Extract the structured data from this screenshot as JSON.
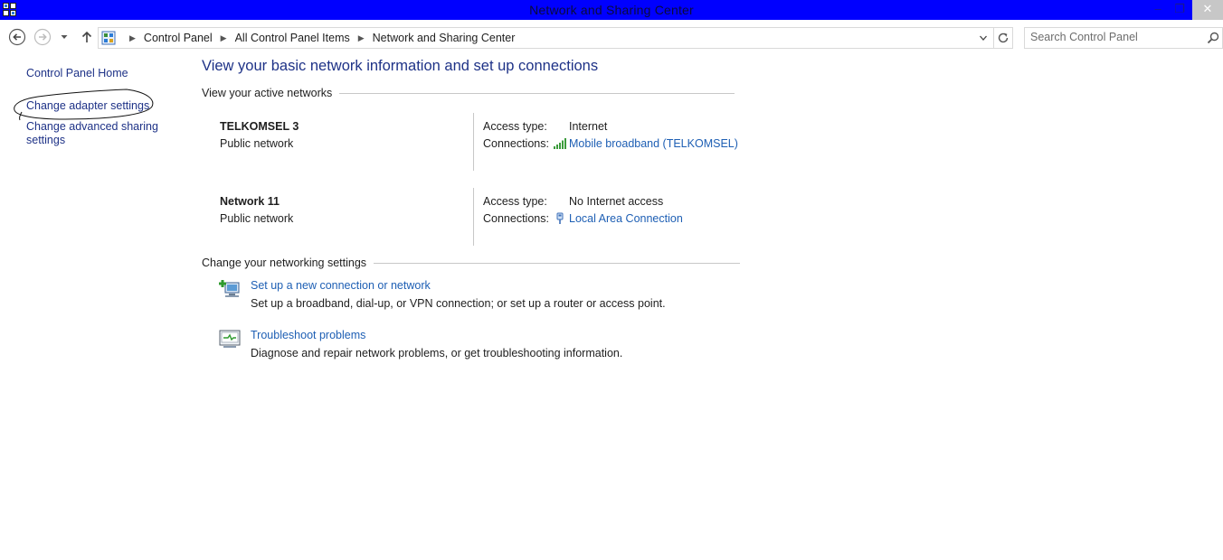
{
  "window": {
    "title": "Network and Sharing Center",
    "minimize_glyph": "–",
    "maximize_glyph": "❐",
    "close_glyph": "✕",
    "title_bar_color": "#0000ff"
  },
  "nav": {
    "back_icon": "back-arrow-icon",
    "forward_icon": "forward-arrow-icon",
    "up_icon": "up-arrow-icon",
    "breadcrumbs": [
      "Control Panel",
      "All Control Panel Items",
      "Network and Sharing Center"
    ],
    "search_placeholder": "Search Control Panel"
  },
  "sidebar": {
    "items": [
      {
        "label": "Control Panel Home"
      },
      {
        "label": "Change adapter settings"
      },
      {
        "label": "Change advanced sharing settings"
      }
    ]
  },
  "main": {
    "heading": "View your basic network information and set up connections",
    "active_networks_title": "View your active networks",
    "networks": [
      {
        "name": "TELKOMSEL  3",
        "type": "Public network",
        "access_label": "Access type:",
        "access_value": "Internet",
        "connections_label": "Connections:",
        "connection_name": "Mobile broadband (TELKOMSEL)",
        "connection_icon": "signal-bars-icon"
      },
      {
        "name": "Network  11",
        "type": "Public network",
        "access_label": "Access type:",
        "access_value": "No Internet access",
        "connections_label": "Connections:",
        "connection_name": "Local Area Connection",
        "connection_icon": "ethernet-plug-icon"
      }
    ],
    "settings_title": "Change your networking settings",
    "tasks": [
      {
        "link": "Set up a new connection or network",
        "description": "Set up a broadband, dial-up, or VPN connection; or set up a router or access point.",
        "icon": "new-connection-icon"
      },
      {
        "link": "Troubleshoot problems",
        "description": "Diagnose and repair network problems, or get troubleshooting information.",
        "icon": "troubleshoot-icon"
      }
    ]
  },
  "colors": {
    "link": "#1e5fb4",
    "heading": "#1e3287",
    "sidebar_link": "#1e3287"
  }
}
